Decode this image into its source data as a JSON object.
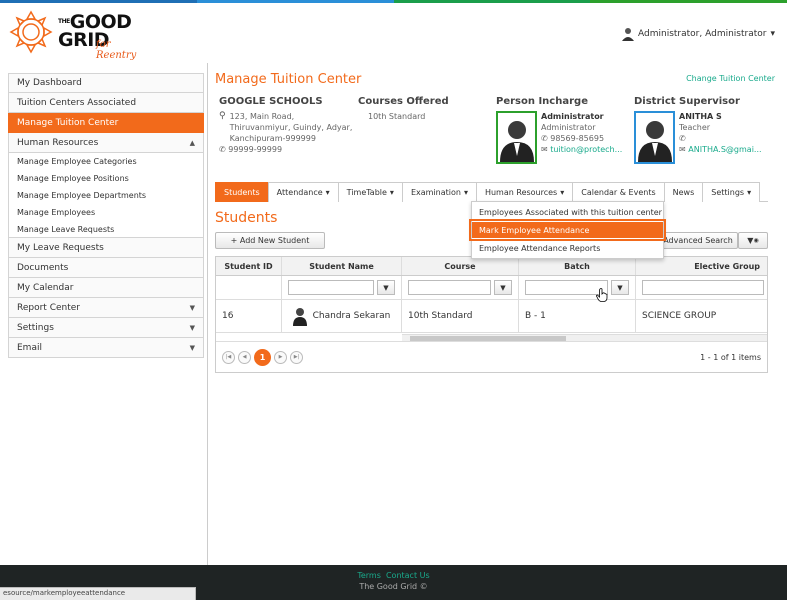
{
  "colors": {
    "accent": "#f26a1b",
    "teal": "#1aaa8c",
    "stripe": [
      "#1f6fb5",
      "#2a8fd8",
      "#1b9e4b",
      "#2ca02c"
    ]
  },
  "brand": {
    "logo_text_line1": "GOOD",
    "logo_text_line2": "GRID",
    "logo_prefix": "THE",
    "logo_sub": "for Reentry"
  },
  "user": {
    "name": "Administrator, Administrator",
    "icon": "user-avatar-icon"
  },
  "sidebar": {
    "items": [
      {
        "label": "My Dashboard"
      },
      {
        "label": "Tuition Centers Associated"
      },
      {
        "label": "Manage Tuition Center",
        "active": true
      },
      {
        "label": "Human Resources",
        "arrow": "▲"
      }
    ],
    "hr_sub": [
      "Manage Employee Categories",
      "Manage Employee Positions",
      "Manage Employee Departments",
      "Manage Employees",
      "Manage Leave Requests"
    ],
    "items2": [
      {
        "label": "My Leave Requests"
      },
      {
        "label": "Documents"
      },
      {
        "label": "My Calendar"
      },
      {
        "label": "Report Center",
        "arrow": "▼"
      },
      {
        "label": "Settings",
        "arrow": "▼"
      },
      {
        "label": "Email",
        "arrow": "▼"
      }
    ]
  },
  "main": {
    "title": "Manage Tuition Center",
    "change_link": "Change Tuition Center",
    "school": {
      "name": "GOOGLE SCHOOLS",
      "address": [
        "123, Main Road,",
        "Thiruvanmiyur, Guindy, Adyar,",
        "Kanchipuram-999999"
      ],
      "phone": "99999-99999"
    },
    "courses": {
      "heading": "Courses Offered",
      "value": "10th Standard"
    },
    "incharge": {
      "heading": "Person Incharge",
      "name": "Administrator",
      "role": "Administrator",
      "phone": "98569-85695",
      "email": "tuition@protech..."
    },
    "supervisor": {
      "heading": "District Supervisor",
      "name": "ANITHA S",
      "role": "Teacher",
      "phone": "",
      "email": "ANITHA.S@gmai..."
    }
  },
  "tabs": [
    {
      "label": "Students",
      "active": true,
      "caret": ""
    },
    {
      "label": "Attendance",
      "caret": "▾"
    },
    {
      "label": "TimeTable",
      "caret": "▾"
    },
    {
      "label": "Examination",
      "caret": "▾"
    },
    {
      "label": "Human Resources",
      "caret": "▾"
    },
    {
      "label": "Calendar & Events",
      "caret": ""
    },
    {
      "label": "News",
      "caret": ""
    },
    {
      "label": "Settings",
      "caret": "▾"
    }
  ],
  "dropdown": {
    "items": [
      "Employees Associated with this tuition center",
      "Mark Employee Attendance",
      "Employee Attendance Reports"
    ]
  },
  "students": {
    "title": "Students",
    "add_label": "+ Add New Student",
    "adv_label": "Advanced Search",
    "columns": [
      "Student ID",
      "Student Name",
      "Course",
      "Batch",
      "Elective Group"
    ],
    "rows": [
      {
        "id": "16",
        "name": "Chandra Sekaran",
        "course": "10th Standard",
        "batch": "B - 1",
        "elective": "SCIENCE GROUP"
      }
    ],
    "pager": {
      "current": "1",
      "info": "1 - 1 of 1 items"
    }
  },
  "footer": {
    "terms": "Terms",
    "contact": "Contact Us",
    "copy": "The Good Grid ©"
  },
  "status_url": "esource/markemployeeattendance"
}
